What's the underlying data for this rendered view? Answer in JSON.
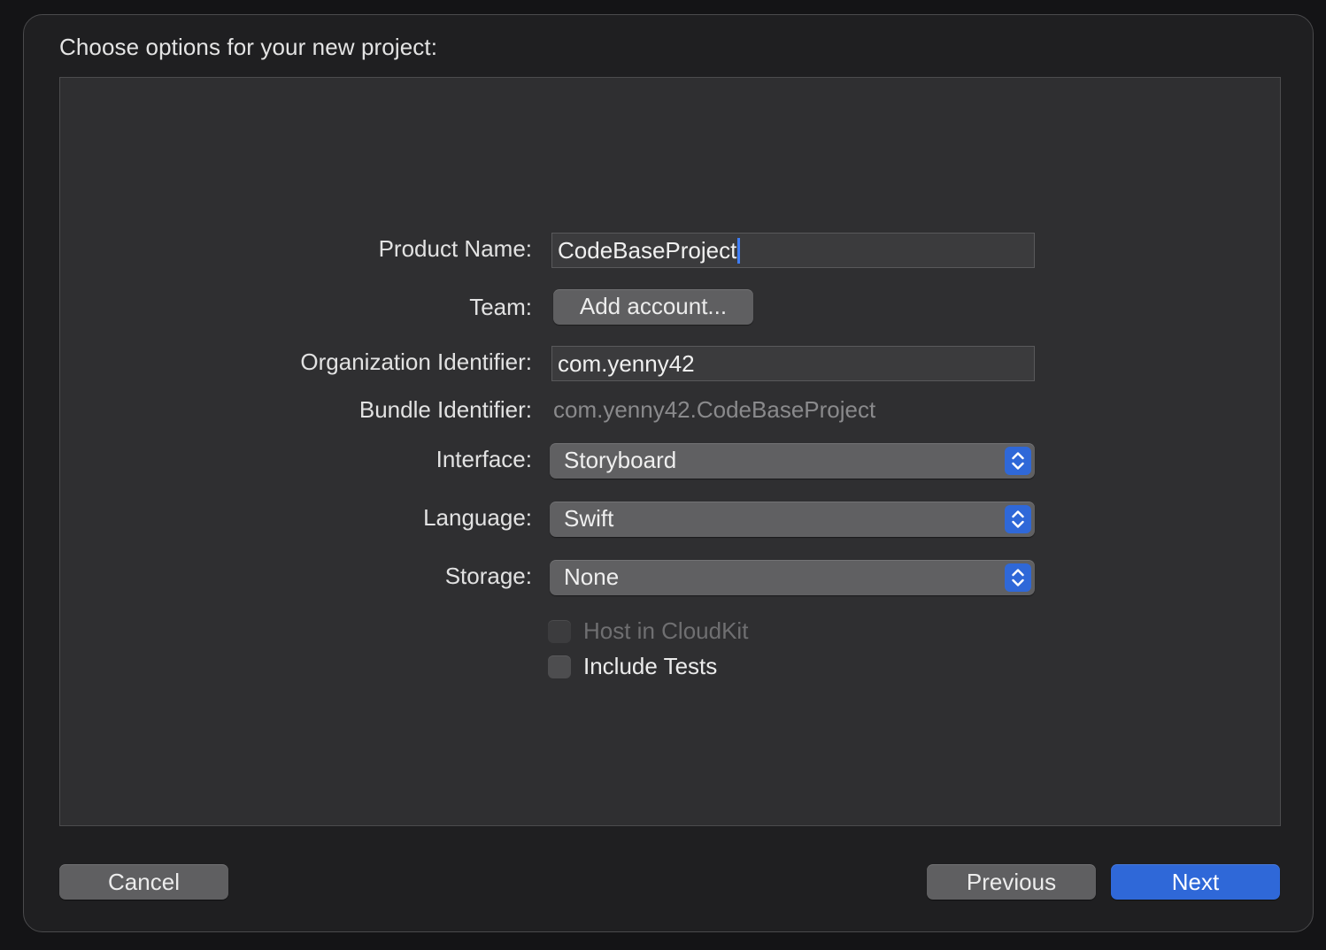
{
  "dialog": {
    "heading": "Choose options for your new project:"
  },
  "form": {
    "product_name_label": "Product Name:",
    "product_name_value": "CodeBaseProject",
    "team_label": "Team:",
    "team_button": "Add account...",
    "org_id_label": "Organization Identifier:",
    "org_id_value": "com.yenny42",
    "bundle_id_label": "Bundle Identifier:",
    "bundle_id_value": "com.yenny42.CodeBaseProject",
    "interface_label": "Interface:",
    "interface_value": "Storyboard",
    "language_label": "Language:",
    "language_value": "Swift",
    "storage_label": "Storage:",
    "storage_value": "None",
    "host_cloudkit_label": "Host in CloudKit",
    "host_cloudkit_checked": false,
    "host_cloudkit_enabled": false,
    "include_tests_label": "Include Tests",
    "include_tests_checked": false
  },
  "footer": {
    "cancel_label": "Cancel",
    "previous_label": "Previous",
    "next_label": "Next"
  },
  "colors": {
    "accent": "#2f68d8",
    "caret": "#3f7ef7",
    "sheet_bg": "#1f1f21",
    "panel_bg": "#2f2f31"
  },
  "icons": {
    "popup_indicator": "chevron-up-down-icon"
  }
}
